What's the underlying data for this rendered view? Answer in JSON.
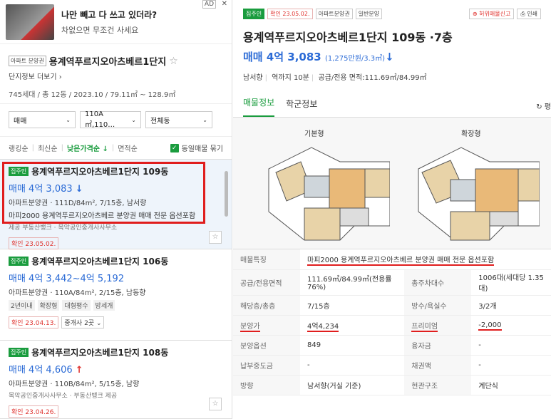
{
  "ad": {
    "title": "나만 빼고 다 쓰고 있더라?",
    "subtitle": "차없으면 무조건 사세요",
    "badge": "AD",
    "close": "✕"
  },
  "complex": {
    "tag": "아파트 분양권",
    "name": "용계역푸르지오아츠베르1단지",
    "more": "단지정보 더보기",
    "info": "745세대 / 총 12동 / 2023.10 / 79.11㎡ ~ 128.9㎡"
  },
  "filters": {
    "trade": "매매",
    "area": "110A㎡,110…",
    "dong": "전체동"
  },
  "sort": {
    "items": [
      "랭킹순",
      "최신순",
      "낮은가격순 ↓",
      "면적순"
    ],
    "active_index": 2,
    "checkbox_label": "동일매물 묶기"
  },
  "listings": [
    {
      "badge": "집주인",
      "name": "용계역푸르지오아츠베르1단지 109동",
      "price": "매매 4억 3,083",
      "trend": "↓",
      "desc": "아파트분양권 · 111D/84m², 7/15층, 남서향",
      "desc2": "마피2000 용계역푸르지오아츠베르 분양권 매매 전문 옵션포함",
      "agent": "제공 부동산뱅크 · 목악공인중개사사무소",
      "confirm": "확인 23.05.02."
    },
    {
      "badge": "집주인",
      "name": "용계역푸르지오아츠베르1단지 106동",
      "price": "매매 4억 3,442~4억 5,192",
      "desc": "아파트분양권 · 110A/84m², 2/15층, 남동향",
      "chips": [
        "2년이내",
        "확장형",
        "대형평수",
        "방세개"
      ],
      "confirm": "확인 23.04.13.",
      "brokers": "중개사 2곳 ⌄"
    },
    {
      "badge": "집주인",
      "name": "용계역푸르지오아츠베르1단지 108동",
      "price": "매매 4억 4,606",
      "trend": "↑",
      "desc": "아파트분양권 · 110B/84m², 5/15층, 남향",
      "agent": "목악공인중개사사무소 · 부동산뱅크 제공",
      "confirm": "확인 23.04.26."
    }
  ],
  "detail": {
    "badges": [
      "집주인",
      "확인 23.05.02.",
      "아파트분양권",
      "일반분양"
    ],
    "actions": {
      "report": "⊕ 허위매물신고",
      "print": "⎙ 인쇄"
    },
    "title": "용계역푸르지오아츠베르1단지 109동 ·7층",
    "price": "매매 4억 3,083",
    "price_unit": "(1,275만원/3.3㎡)",
    "trend": "↓",
    "meta": [
      "남서향",
      "역까지 10분",
      "공급/전용 면적:111.69㎡/84.99㎡"
    ],
    "tabs": [
      "매물정보",
      "학군정보"
    ],
    "refresh": "↻ 평",
    "plans": [
      "기본형",
      "확장형"
    ],
    "table": [
      {
        "k1": "매물특징",
        "v1": "마피2000 용계역푸르지오아츠베르 분양권 매매 전문 옵션포함",
        "full": true
      },
      {
        "k1": "공급/전용면적",
        "v1": "111.69㎡/84.99㎡(전용률76%)",
        "k2": "총주차대수",
        "v2": "1006대(세대당 1.35대)"
      },
      {
        "k1": "해당층/총층",
        "v1": "7/15층",
        "k2": "방수/욕실수",
        "v2": "3/2개"
      },
      {
        "k1": "분양가",
        "v1": "4억4,234",
        "k2": "프리미엄",
        "v2": "-2,000"
      },
      {
        "k1": "분양옵션",
        "v1": "849",
        "k2": "융자금",
        "v2": "-"
      },
      {
        "k1": "납부중도금",
        "v1": "-",
        "k2": "채권액",
        "v2": "-"
      },
      {
        "k1": "방향",
        "v1": "남서향(거실 기준)",
        "k2": "현관구조",
        "v2": "계단식"
      }
    ]
  }
}
